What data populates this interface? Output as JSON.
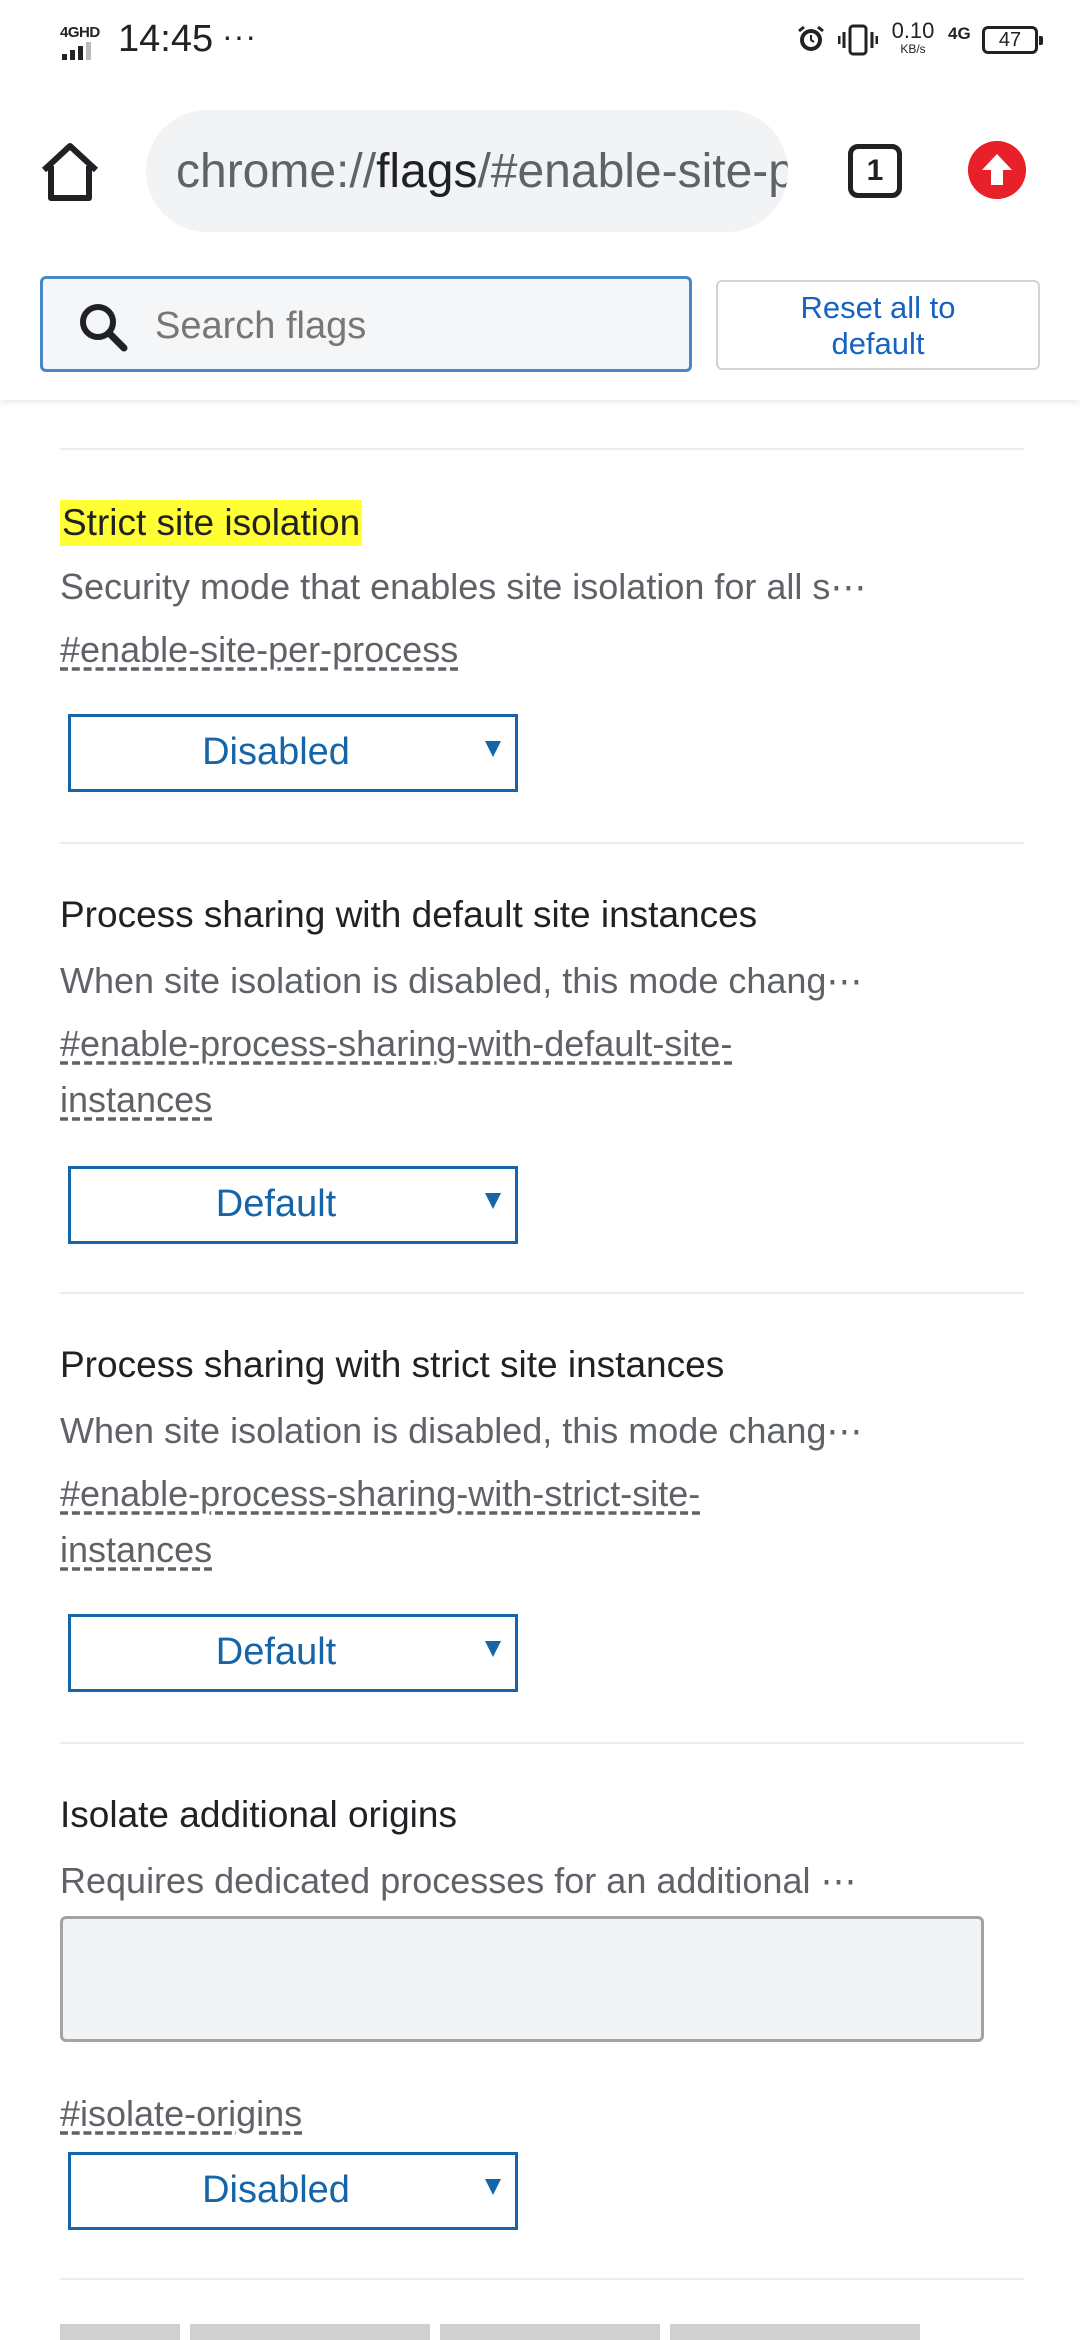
{
  "status_bar": {
    "network_label": "4GHD",
    "time": "14:45",
    "overflow_dots": "···",
    "speed_value": "0.10",
    "speed_unit": "KB/s",
    "mobile_data": "4G",
    "battery": "47"
  },
  "toolbar": {
    "url_scheme": "chrome://",
    "url_host": "flags",
    "url_rest": "/#enable-site-per-process",
    "tab_count": "1"
  },
  "search": {
    "placeholder": "Search flags",
    "reset_label_line1": "Reset all to",
    "reset_label_line2": "default"
  },
  "flags": [
    {
      "title": "Strict site isolation",
      "highlighted": true,
      "description": "Security mode that enables site isolation for all s⋯",
      "link": "#enable-site-per-process",
      "value": "Disabled"
    },
    {
      "title": "Process sharing with default site instances",
      "highlighted": false,
      "description": "When site isolation is disabled, this mode chang⋯",
      "link_line1": "#enable-process-sharing-with-default-site-",
      "link_line2": "instances",
      "value": "Default"
    },
    {
      "title": "Process sharing with strict site instances",
      "highlighted": false,
      "description": "When site isolation is disabled, this mode chang⋯",
      "link_line1": "#enable-process-sharing-with-strict-site-",
      "link_line2": "instances",
      "value": "Default"
    },
    {
      "title": "Isolate additional origins",
      "highlighted": false,
      "description": "Requires dedicated processes for an additional ⋯",
      "link": "#isolate-origins",
      "value": "Disabled"
    }
  ],
  "colors": {
    "highlight": "#ffff33",
    "link_blue": "#1565a8",
    "update_red": "#e8202a"
  },
  "icons": [
    "home-icon",
    "search-icon",
    "update-arrow-icon",
    "alarm-icon",
    "vibrate-icon"
  ]
}
